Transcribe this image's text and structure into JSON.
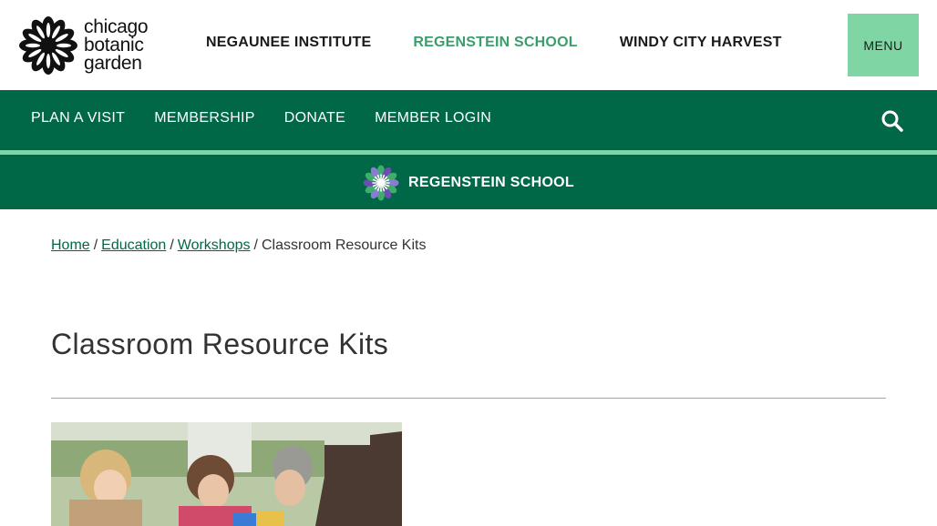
{
  "logo": {
    "line1": "chicago",
    "line2": "botanic",
    "line3": "garden"
  },
  "institutes": [
    {
      "label": "NEGAUNEE INSTITUTE",
      "active": false
    },
    {
      "label": "REGENSTEIN SCHOOL",
      "active": true
    },
    {
      "label": "WINDY CITY HARVEST",
      "active": false
    }
  ],
  "menu_label": "MENU",
  "main_nav": [
    {
      "label": "PLAN A VISIT"
    },
    {
      "label": "MEMBERSHIP"
    },
    {
      "label": "DONATE"
    },
    {
      "label": "MEMBER LOGIN"
    }
  ],
  "school_banner": {
    "label": "REGENSTEIN SCHOOL"
  },
  "breadcrumb": {
    "items": [
      {
        "label": "Home"
      },
      {
        "label": "Education"
      },
      {
        "label": "Workshops"
      }
    ],
    "separator": "/",
    "current": "Classroom Resource Kits"
  },
  "page_title": "Classroom Resource Kits",
  "colors": {
    "brand_green": "#006847",
    "accent_mint": "#7fd6a4",
    "active_link": "#3a9e6c"
  },
  "icons": {
    "search": "search-icon",
    "logo": "flower-logo-icon",
    "school": "school-burst-icon"
  }
}
